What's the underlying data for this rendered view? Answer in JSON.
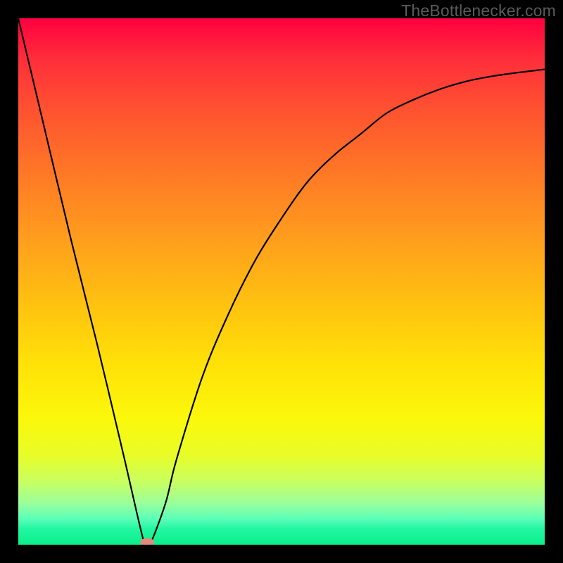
{
  "watermark": "TheBottlenecker.com",
  "chart_data": {
    "type": "line",
    "title": "",
    "xlabel": "",
    "ylabel": "",
    "xlim": [
      0,
      100
    ],
    "ylim": [
      0,
      100
    ],
    "series": [
      {
        "name": "bottleneck-curve",
        "x": [
          0,
          5,
          10,
          15,
          20,
          24,
          25,
          28,
          30,
          35,
          40,
          45,
          50,
          55,
          60,
          65,
          70,
          75,
          80,
          85,
          90,
          95,
          100
        ],
        "values": [
          100,
          79,
          58,
          38,
          17,
          0,
          0,
          8,
          16,
          32,
          44,
          54,
          62,
          69,
          74,
          78,
          82,
          84.5,
          86.5,
          88,
          89,
          89.7,
          90.3
        ]
      }
    ],
    "annotations": [
      {
        "name": "vertex-marker",
        "x": 24.5,
        "y": 0.5,
        "shape": "ellipse",
        "color": "#e18b7d"
      }
    ],
    "background_gradient": {
      "direction": "vertical",
      "stops": [
        {
          "pos": 0.0,
          "color": "#ff0040"
        },
        {
          "pos": 0.5,
          "color": "#ffbe10"
        },
        {
          "pos": 0.78,
          "color": "#f9fb12"
        },
        {
          "pos": 1.0,
          "color": "#0af08a"
        }
      ]
    }
  }
}
